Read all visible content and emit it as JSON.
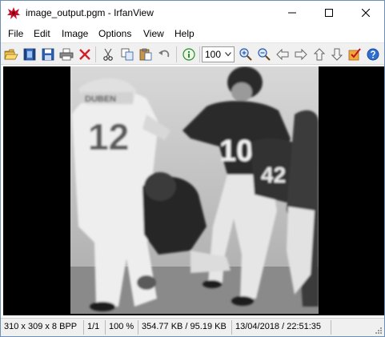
{
  "window": {
    "title": "image_output.pgm - IrfanView"
  },
  "menu": {
    "items": [
      "File",
      "Edit",
      "Image",
      "Options",
      "View",
      "Help"
    ]
  },
  "toolbar": {
    "zoom_value": "100",
    "icons": [
      "open-folder-icon",
      "slideshow-icon",
      "save-icon",
      "print-icon",
      "delete-icon",
      "cut-icon",
      "copy-icon",
      "paste-icon",
      "undo-icon",
      "info-icon",
      "zoom-in-icon",
      "zoom-out-icon",
      "previous-arrow-icon",
      "next-arrow-icon",
      "first-file-icon",
      "last-file-icon",
      "properties-icon",
      "help-icon"
    ]
  },
  "image": {
    "jersey_left": "12",
    "name_left": "DUBEN",
    "jersey_right": "10",
    "jersey_back": "42"
  },
  "status": {
    "dimensions": "310 x 309 x 8 BPP",
    "page": "1/1",
    "zoom": "100 %",
    "size": "354.77 KB / 95.19 KB",
    "datetime": "13/04/2018 / 22:51:35"
  },
  "colors": {
    "frame": "#6d8fb5",
    "viewport": "#000000",
    "toolbar_bg": "#f0f0f0"
  }
}
